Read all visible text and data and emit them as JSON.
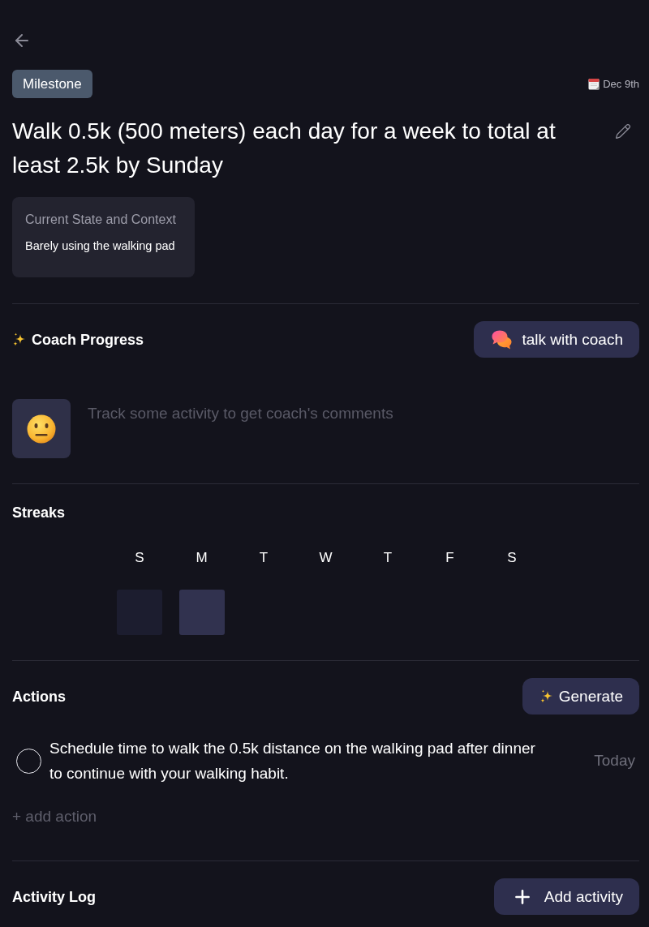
{
  "goal": {
    "tag": "Milestone",
    "date": "Dec 9th",
    "title": "Walk 0.5k (500 meters) each day for a week to total at least 2.5k by Sunday",
    "context": {
      "label": "Current State and Context",
      "value": "Barely using the walking pad"
    }
  },
  "coach": {
    "title": "Coach Progress",
    "button": "talk with coach",
    "message": "Track some activity to get coach's comments"
  },
  "streaks": {
    "title": "Streaks",
    "days": [
      {
        "label": "S",
        "past": true,
        "selected": false
      },
      {
        "label": "M",
        "past": false,
        "selected": true
      },
      {
        "label": "T",
        "past": false,
        "selected": false
      },
      {
        "label": "W",
        "past": false,
        "selected": false
      },
      {
        "label": "T",
        "past": false,
        "selected": false
      },
      {
        "label": "F",
        "past": false,
        "selected": false
      },
      {
        "label": "S",
        "past": false,
        "selected": false
      }
    ]
  },
  "actions": {
    "title": "Actions",
    "button": "Generate",
    "items": [
      {
        "text": "Schedule time to walk the 0.5k distance on the walking pad after dinner to continue with your walking habit.",
        "due": "Today",
        "checked": false
      }
    ],
    "add_label": "+ add action"
  },
  "activity_log": {
    "title": "Activity Log",
    "button": "Add activity"
  }
}
